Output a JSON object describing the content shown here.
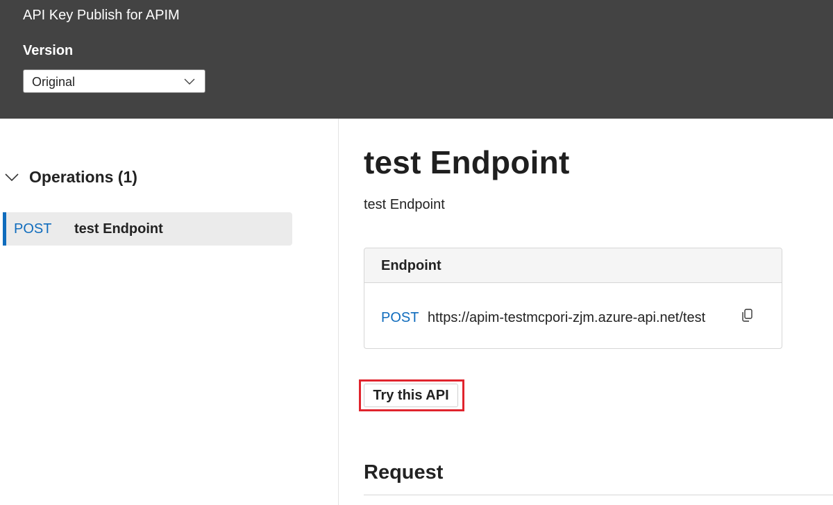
{
  "header": {
    "api_title": "API Key Publish for APIM",
    "version_label": "Version",
    "version_selected": "Original"
  },
  "sidebar": {
    "operations_title": "Operations (1)",
    "operations": [
      {
        "method": "POST",
        "name": "test Endpoint",
        "selected": true
      }
    ]
  },
  "main": {
    "title": "test Endpoint",
    "description": "test Endpoint",
    "endpoint": {
      "card_title": "Endpoint",
      "method": "POST",
      "url": "https://apim-testmcpori-zjm.azure-api.net/test"
    },
    "try_button_label": "Try this API",
    "request_heading": "Request"
  },
  "icons": {
    "version_dropdown": "chevron-down-icon",
    "operations_toggle": "chevron-down-icon",
    "copy_url": "copy-icon"
  },
  "colors": {
    "header_bg": "#434343",
    "method_blue": "#0f6cbd",
    "highlight_red": "#e0242d",
    "selected_bg": "#ebebeb"
  }
}
